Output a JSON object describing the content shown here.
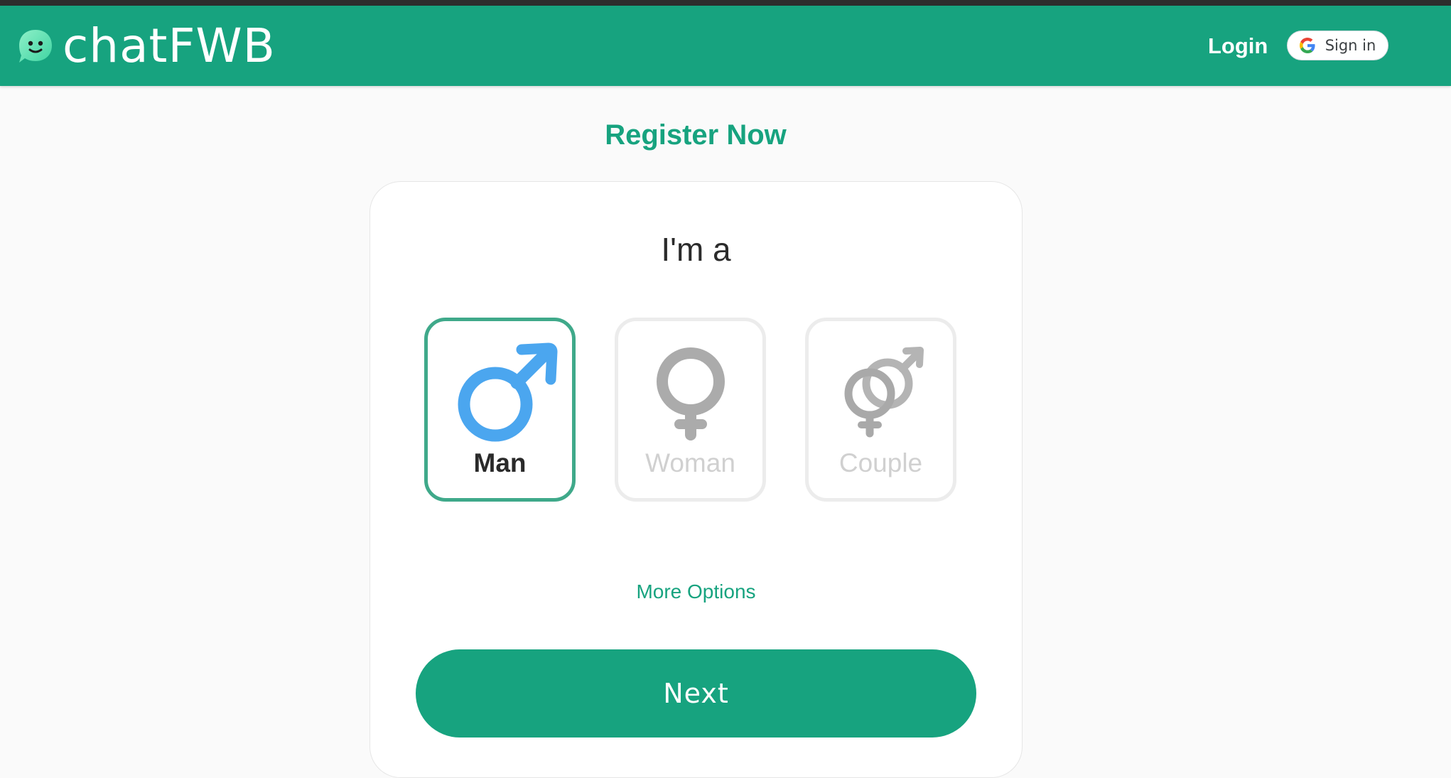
{
  "header": {
    "brand": "chatFWB",
    "login_label": "Login",
    "google_signin_label": "Sign in"
  },
  "register_title": "Register Now",
  "card": {
    "heading": "I'm a",
    "options": [
      {
        "label": "Man",
        "icon": "male-symbol-icon",
        "selected": true
      },
      {
        "label": "Woman",
        "icon": "female-symbol-icon",
        "selected": false
      },
      {
        "label": "Couple",
        "icon": "couple-symbol-icon",
        "selected": false
      }
    ],
    "more_options_label": "More Options",
    "next_label": "Next"
  },
  "colors": {
    "brand_green": "#17a37f",
    "selected_border": "#3fa98a",
    "male_blue": "#4ba6ef",
    "inactive_icon": "#ababab"
  }
}
